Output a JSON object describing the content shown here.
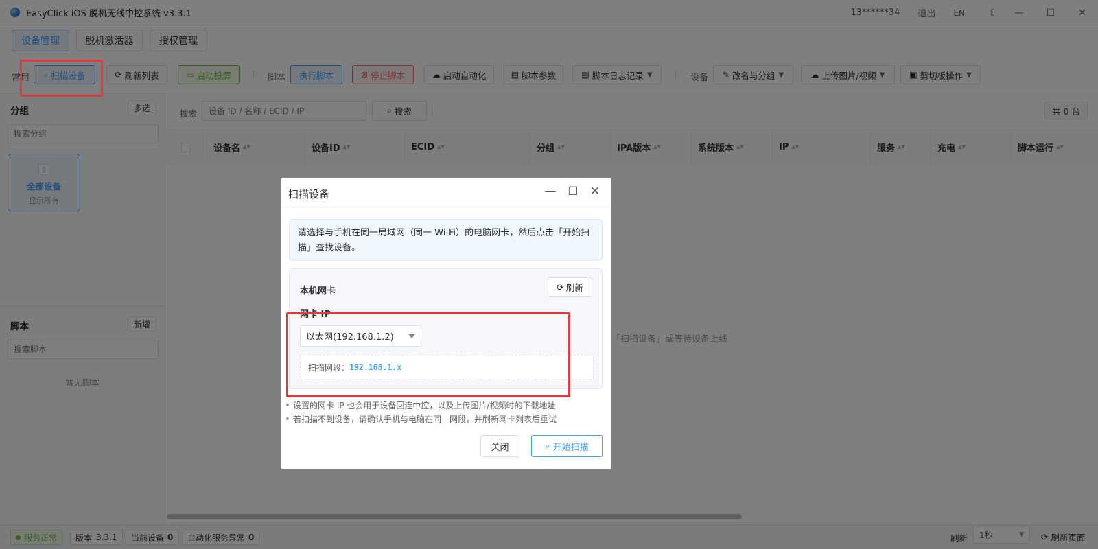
{
  "window": {
    "title": "EasyClick iOS 脱机无线中控系统 v3.3.1",
    "user": "13******34",
    "logout": "退出",
    "lang": "EN"
  },
  "tabs": [
    {
      "label": "设备管理",
      "active": true
    },
    {
      "label": "脱机激活器",
      "active": false
    },
    {
      "label": "授权管理",
      "active": false
    }
  ],
  "toolbar": {
    "common_label": "常用",
    "scan": "扫描设备",
    "refresh_list": "刷新列表",
    "start_mirror": "启动投屏",
    "script_label": "脚本",
    "run_script": "执行脚本",
    "stop_script": "停止脚本",
    "start_automation": "启动自动化",
    "script_params": "脚本参数",
    "script_logs": "脚本日志记录",
    "device_label": "设备",
    "rename_group": "改名与分组",
    "upload_media": "上传图片/视频",
    "clipboard": "剪切板操作"
  },
  "sidebar": {
    "group_title": "分组",
    "multi_select": "多选",
    "group_search_placeholder": "搜索分组",
    "all_devices": "全部设备",
    "show_all": "显示所有",
    "script_title": "脚本",
    "add": "新增",
    "script_search_placeholder": "搜索脚本",
    "no_scripts": "暂无脚本"
  },
  "main": {
    "search_label": "搜索",
    "search_placeholder": "设备 ID / 名称 / ECID / IP",
    "search_button": "搜索",
    "total": "共 0 台",
    "columns": [
      "设备名",
      "设备ID",
      "ECID",
      "分组",
      "IPA版本",
      "系统版本",
      "IP",
      "服务",
      "充电",
      "脚本运行"
    ],
    "empty_hint": "「扫描设备」或等待设备上线"
  },
  "modal": {
    "title": "扫描设备",
    "info_line1": "请选择与手机在同一局域网（同一 Wi-Fi）的电脑网卡，然后点击「开始扫",
    "info_line2": "描」查找设备。",
    "nic_title": "本机网卡",
    "refresh": "刷新",
    "nic_ip_label": "网卡 IP",
    "nic_selected": "以太网(192.168.1.2)",
    "segment_label": "扫描网段：",
    "segment_value": "192.168.1.x",
    "hint1": "设置的网卡 IP 也会用于设备回连中控，以及上传图片/视频时的下载地址",
    "hint2": "若扫描不到设备，请确认手机与电脑在同一网段，并刷新网卡列表后重试",
    "close": "关闭",
    "start_scan": "开始扫描"
  },
  "statusbar": {
    "service": "服务正常",
    "version_label": "版本",
    "version": "3.3.1",
    "current_devices_label": "当前设备",
    "current_devices": "0",
    "automation_error_label": "自动化服务异常",
    "automation_error": "0",
    "refresh_label": "刷新",
    "refresh_interval": "1秒",
    "refresh_page": "刷新页面"
  },
  "colors": {
    "primary": "#409eff",
    "success": "#67c23a",
    "danger": "#f56c6c",
    "highlight": "#e5383b"
  }
}
